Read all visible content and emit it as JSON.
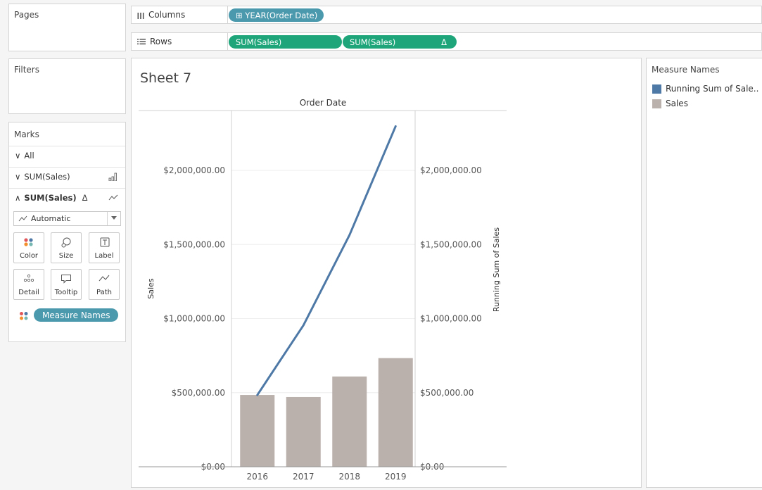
{
  "pages_panel": {
    "title": "Pages"
  },
  "filters_panel": {
    "title": "Filters"
  },
  "columns_shelf": {
    "label": "Columns",
    "pills": [
      "⊞ YEAR(Order Date)"
    ]
  },
  "rows_shelf": {
    "label": "Rows",
    "pills": [
      "SUM(Sales)",
      "SUM(Sales)"
    ],
    "delta_symbol": "Δ"
  },
  "marks": {
    "title": "Marks",
    "rows": [
      {
        "label": "All",
        "chevron": "∨"
      },
      {
        "label": "SUM(Sales)",
        "chevron": "∨"
      },
      {
        "label": "SUM(Sales)",
        "chevron": "∧",
        "delta": "Δ"
      }
    ],
    "mark_type": "Automatic",
    "cards": [
      "Color",
      "Size",
      "Label",
      "Detail",
      "Tooltip",
      "Path"
    ],
    "color_pill": "Measure Names"
  },
  "sheet": {
    "title": "Sheet 7",
    "header": "Order Date"
  },
  "legend": {
    "title": "Measure Names",
    "items": [
      {
        "label": "Running Sum of Sale..",
        "color": "#4e79a7"
      },
      {
        "label": "Sales",
        "color": "#bab0ac"
      }
    ]
  },
  "chart_data": {
    "type": "bar",
    "categories": [
      "2016",
      "2017",
      "2018",
      "2019"
    ],
    "series": [
      {
        "name": "Sales",
        "type": "bar",
        "values": [
          484247,
          470533,
          609206,
          733215
        ],
        "color": "#bab0ac"
      },
      {
        "name": "Running Sum of Sales",
        "type": "line",
        "values": [
          484247,
          954780,
          1563986,
          2297201
        ],
        "color": "#4e79a7"
      }
    ],
    "ylabel": "Sales",
    "y2label": "Running Sum of Sales",
    "xlabel": "Order Date",
    "ylim": [
      0,
      2440000
    ],
    "yticks": [
      0,
      500000,
      1000000,
      1500000,
      2000000
    ],
    "ytick_labels": [
      "$0.00",
      "$500,000.00",
      "$1,000,000.00",
      "$1,500,000.00",
      "$2,000,000.00"
    ],
    "grid": true,
    "legend_position": "right"
  }
}
